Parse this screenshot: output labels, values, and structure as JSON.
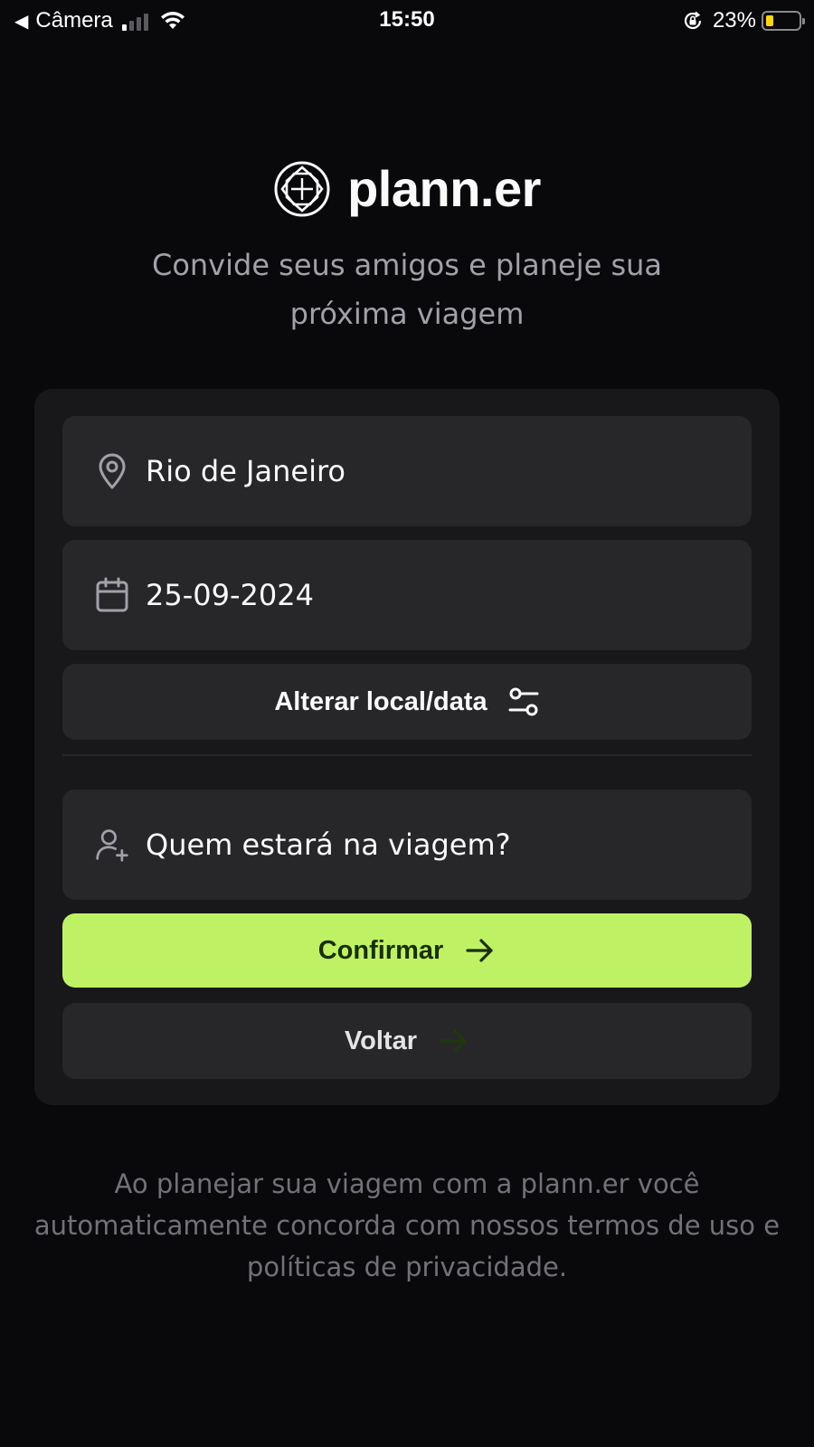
{
  "status_bar": {
    "back_glyph": "◀",
    "app_name": "Câmera",
    "time": "15:50",
    "battery_percent": "23%",
    "battery_level": 0.23,
    "signal_bars_active": 1,
    "icons": [
      "back-arrow-icon",
      "cellular-signal-icon",
      "wifi-icon",
      "rotation-lock-icon",
      "battery-icon"
    ]
  },
  "brand": {
    "name": "plann.er",
    "tagline_line1": "Convide seus amigos e planeje sua",
    "tagline_line2": "próxima viagem",
    "icon": "logo-icon"
  },
  "form": {
    "location": {
      "value": "Rio de Janeiro",
      "icon": "map-pin-icon"
    },
    "date": {
      "value": "25-09-2024",
      "icon": "calendar-icon"
    },
    "change_button": {
      "label": "Alterar local/data",
      "icon": "settings-sliders-icon"
    },
    "guests": {
      "placeholder": "Quem estará na viagem?",
      "icon": "user-plus-icon"
    },
    "confirm_button": {
      "label": "Confirmar",
      "icon": "arrow-right-icon"
    },
    "back_button": {
      "label": "Voltar",
      "icon": "arrow-right-icon"
    }
  },
  "footer": {
    "line1": "Ao planejar sua viagem com a plann.er você",
    "line2": "automaticamente concorda com nossos termos de uso e",
    "line3": "políticas de privacidade."
  },
  "colors": {
    "background": "#09090b",
    "card": "#18181b",
    "field": "#27272a",
    "accent": "#bef264",
    "accent_text": "#1a2e05",
    "muted_text": "#a1a1aa",
    "footer_text": "#71717a",
    "back_arrow": "#1a2e05"
  }
}
